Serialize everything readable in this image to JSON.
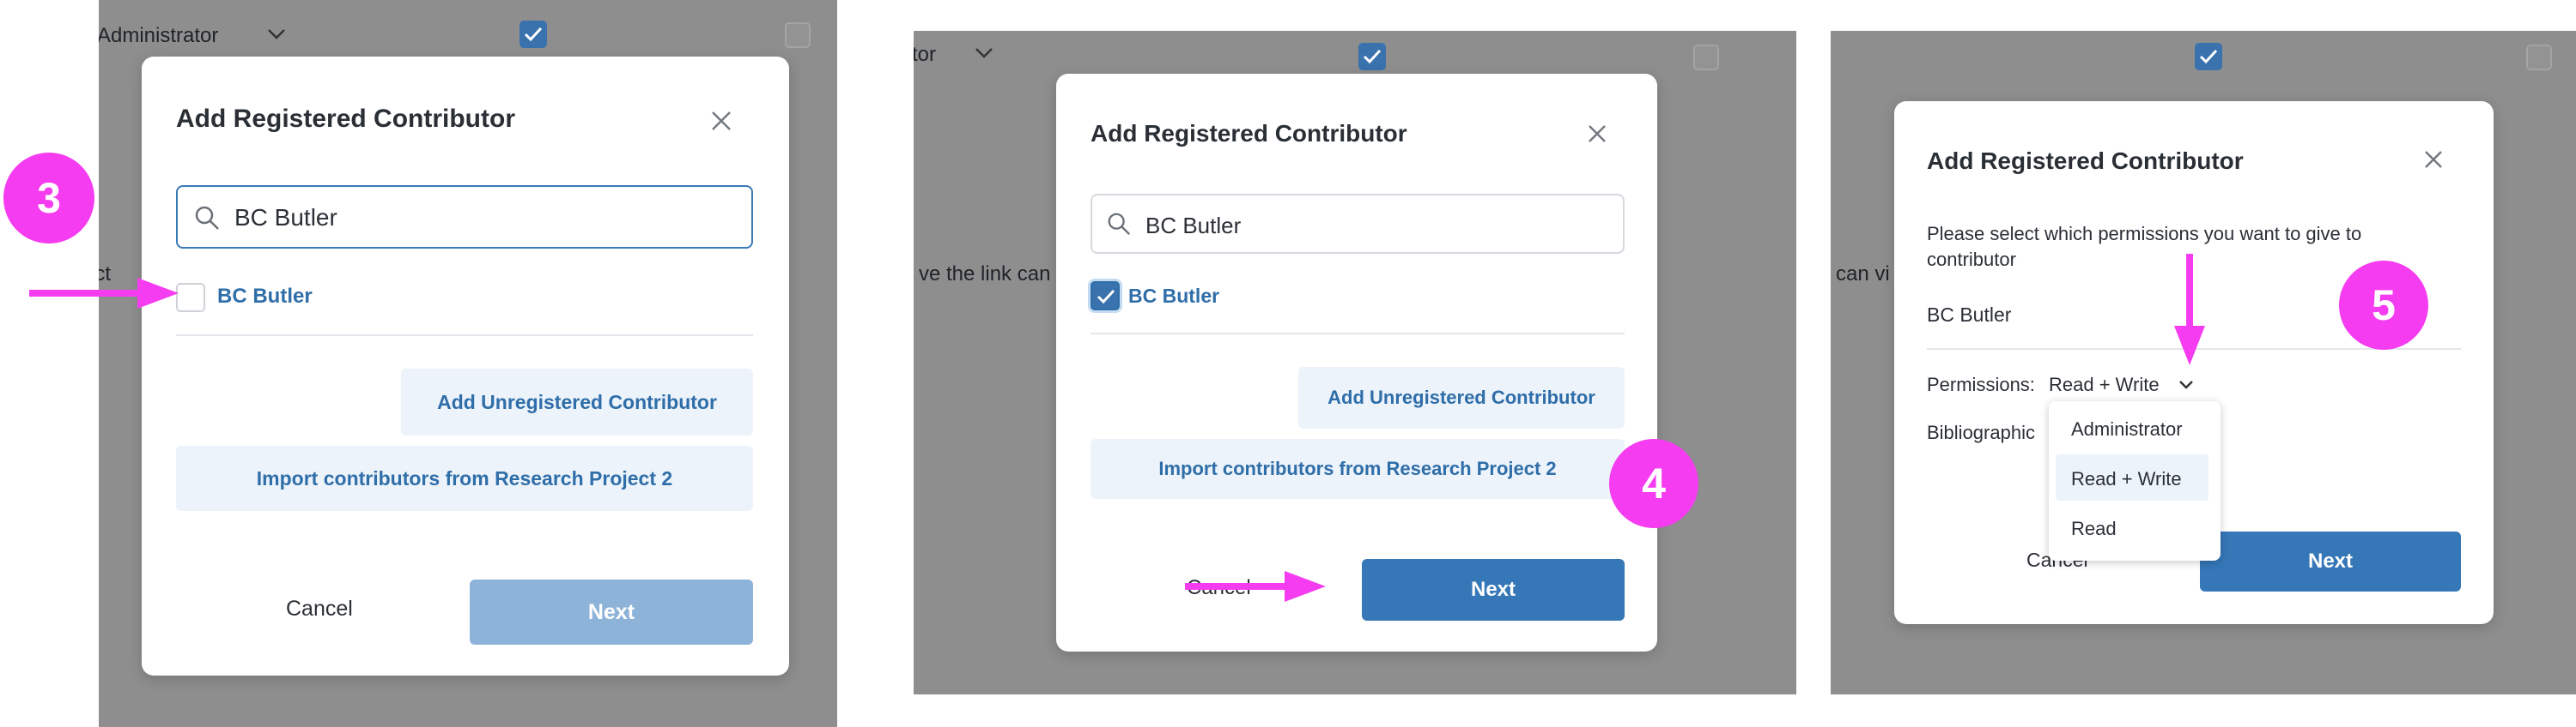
{
  "colors": {
    "accent": "#2f6ea8",
    "primary_button": "#3577b7",
    "disabled_button": "#8eb3d8",
    "light_button": "#ecf3fb",
    "annotation": "#f53cf0",
    "backdrop": "#8e8e8e"
  },
  "panel1": {
    "backdrop": {
      "role_label": "Administrator",
      "partial_text": "ect"
    },
    "modal": {
      "title": "Add Registered Contributor",
      "search_value": "BC Butler",
      "result_name": "BC Butler",
      "result_checked": false,
      "add_unregistered": "Add Unregistered Contributor",
      "import": "Import contributors from Research Project 2",
      "cancel": "Cancel",
      "next": "Next"
    },
    "step": "3"
  },
  "panel2": {
    "backdrop": {
      "role_label": "tor",
      "partial_text": "ve the link can vi"
    },
    "modal": {
      "title": "Add Registered Contributor",
      "search_value": "BC Butler",
      "result_name": "BC Butler",
      "result_checked": true,
      "add_unregistered": "Add Unregistered Contributor",
      "import": "Import contributors from Research Project 2",
      "cancel": "Cancel",
      "next": "Next"
    },
    "step": "4"
  },
  "panel3": {
    "backdrop": {
      "partial_text": "can vi"
    },
    "modal": {
      "title": "Add Registered Contributor",
      "instruction": "Please select which permissions you want to give to contributor",
      "contributor_name": "BC Butler",
      "permissions_label": "Permissions:",
      "permissions_value": "Read + Write",
      "bibliographic_label": "Bibliographic",
      "cancel": "Cancel",
      "next": "Next",
      "dropdown_options": [
        "Administrator",
        "Read + Write",
        "Read"
      ],
      "selected_option": "Read + Write"
    },
    "step": "5"
  }
}
